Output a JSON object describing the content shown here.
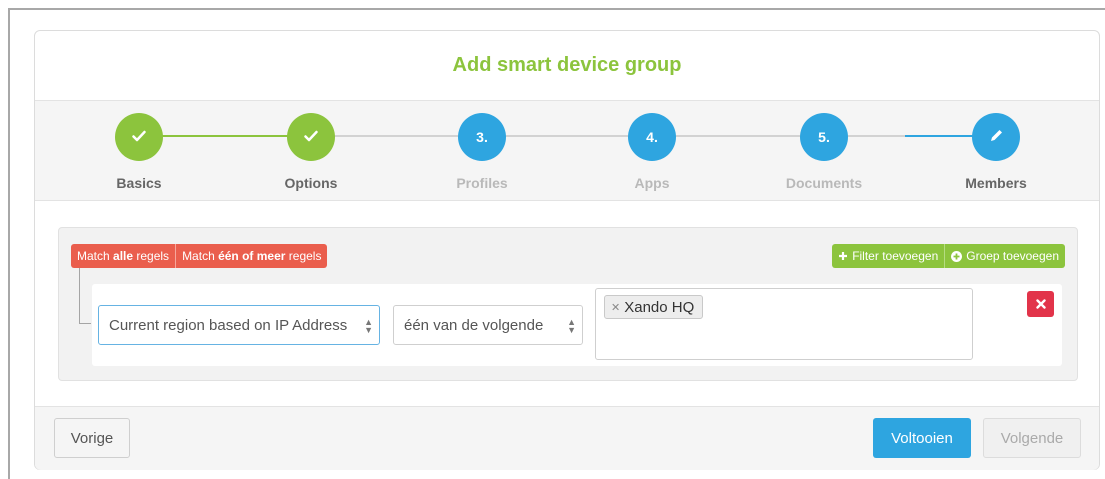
{
  "modal": {
    "title": "Add smart device group"
  },
  "wizard": {
    "steps": [
      {
        "label": "Basics",
        "marker": "✓",
        "state": "done"
      },
      {
        "label": "Options",
        "marker": "✓",
        "state": "done"
      },
      {
        "label": "Profiles",
        "marker": "3.",
        "state": "todo"
      },
      {
        "label": "Apps",
        "marker": "4.",
        "state": "todo"
      },
      {
        "label": "Documents",
        "marker": "5.",
        "state": "todo"
      },
      {
        "label": "Members",
        "marker": "pencil-icon",
        "state": "active"
      }
    ]
  },
  "rules": {
    "match_all": {
      "prefix": "Match ",
      "bold": "alle",
      "suffix": " regels"
    },
    "match_any": {
      "prefix": "Match ",
      "bold": "één of meer",
      "suffix": " regels"
    },
    "add_filter": "Filter toevoegen",
    "add_group": "Groep toevoegen",
    "rule": {
      "field": "Current region based on IP Address",
      "operator": "één van de volgende",
      "values": [
        "Xando HQ"
      ]
    }
  },
  "footer": {
    "prev": "Vorige",
    "finish": "Voltooien",
    "next": "Volgende"
  },
  "colors": {
    "done": "#8cc43d",
    "todo": "#2ea5e0",
    "danger": "#e2344a",
    "match": "#ea5e4d"
  }
}
